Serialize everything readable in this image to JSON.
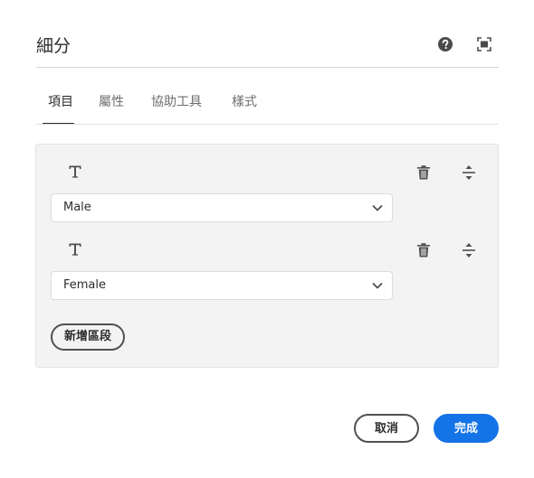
{
  "dialog": {
    "title": "細分",
    "header_icons": [
      "help-icon",
      "fullscreen-icon"
    ]
  },
  "tabs": [
    {
      "label": "項目",
      "active": true
    },
    {
      "label": "屬性",
      "active": false
    },
    {
      "label": "協助工具",
      "active": false
    },
    {
      "label": "樣式",
      "active": false
    }
  ],
  "segments": [
    {
      "type_icon": "text-type-icon",
      "selected": "Male"
    },
    {
      "type_icon": "text-type-icon",
      "selected": "Female"
    }
  ],
  "add_segment_label": "新增區段",
  "footer": {
    "cancel_label": "取消",
    "done_label": "完成"
  },
  "colors": {
    "accent": "#1473e6",
    "panel_bg": "#f3f3f3",
    "text": "#2c2c2c"
  }
}
